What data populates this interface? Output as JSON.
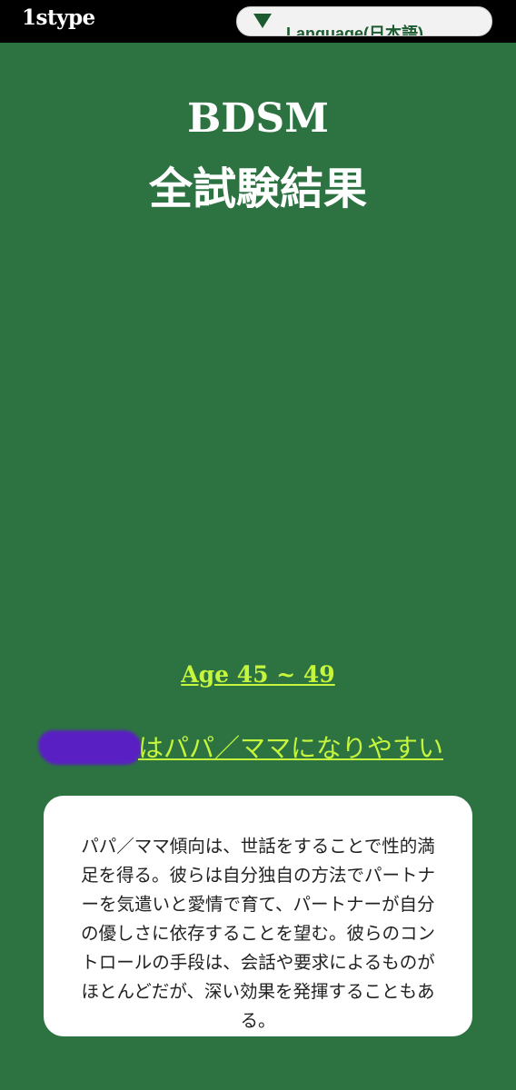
{
  "header": {
    "logo": "1stype",
    "language_select": {
      "label": "Language(日本語)",
      "icon": "triangle-down-icon"
    }
  },
  "title": {
    "line1": "BDSM",
    "line2": "全試験結果"
  },
  "age_link": "Age 45 ~ 49",
  "result": {
    "text": "はパパ／ママになりやすい"
  },
  "description": "パパ／ママ傾向は、世話をすることで性的満足を得る。彼らは自分独自の方法でパートナーを気遣いと愛情で育て、パートナーが自分の優しさに依存することを望む。彼らのコントロールの手段は、会話や要求によるものがほとんどだが、深い効果を発揮することもある。",
  "colors": {
    "background": "#2d7342",
    "topbar": "#000000",
    "accent": "#c5f53c",
    "redaction": "#5a1fc2",
    "language_text": "#1c5a2f"
  }
}
